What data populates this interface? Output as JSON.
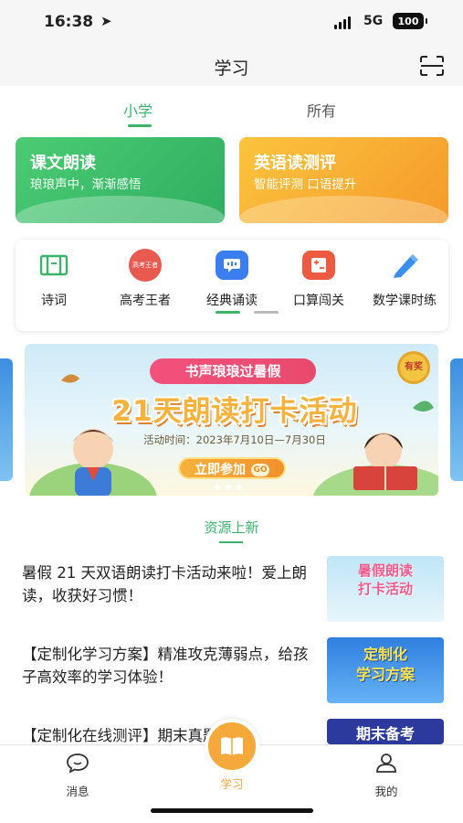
{
  "status": {
    "time": "16:38",
    "network": "5G",
    "battery": "100"
  },
  "nav": {
    "title": "学习"
  },
  "tabs": [
    {
      "label": "小学"
    },
    {
      "label": "所有"
    }
  ],
  "cards": [
    {
      "title": "课文朗读",
      "subtitle": "琅琅声中，渐渐感悟"
    },
    {
      "title": "英语读测评",
      "subtitle": "智能评测  口语提升"
    }
  ],
  "grid": [
    {
      "label": "诗词",
      "icon": "poem-icon",
      "color": "#3bb36a"
    },
    {
      "label": "高考王者",
      "icon": "graduation-cap-icon",
      "color": "#e85a4f",
      "badge": "高考王者"
    },
    {
      "label": "经典诵读",
      "icon": "chat-bubble-icon",
      "color": "#3a7ef0"
    },
    {
      "label": "口算闯关",
      "icon": "calculator-icon",
      "color": "#ee5a3f"
    },
    {
      "label": "数学课时练",
      "icon": "pencil-icon",
      "color": "#3a8ef0"
    }
  ],
  "banner": {
    "pill": "书声琅琅过暑假",
    "title": "21天朗读打卡活动",
    "date": "活动时间：2023年7月10日—7月30日",
    "button": "立即参加",
    "go": "GO",
    "badge": "有奖"
  },
  "section_title": "资源上新",
  "articles": [
    {
      "text": "暑假 21 天双语朗读打卡活动来啦！爱上朗读，收获好习惯！",
      "thumb": "暑假朗读\n打卡活动"
    },
    {
      "text": "【定制化学习方案】精准攻克薄弱点，给孩子高效率的学习体验！",
      "thumb": "定制化\n学习方案"
    },
    {
      "text": "【定制化在线测评】期末真题/期",
      "thumb": "期末备考"
    }
  ],
  "tabbar": [
    {
      "label": "消息"
    },
    {
      "label": "学习"
    },
    {
      "label": "我的"
    }
  ],
  "colors": {
    "accent": "#3bb36a",
    "orange": "#f6a93b"
  }
}
